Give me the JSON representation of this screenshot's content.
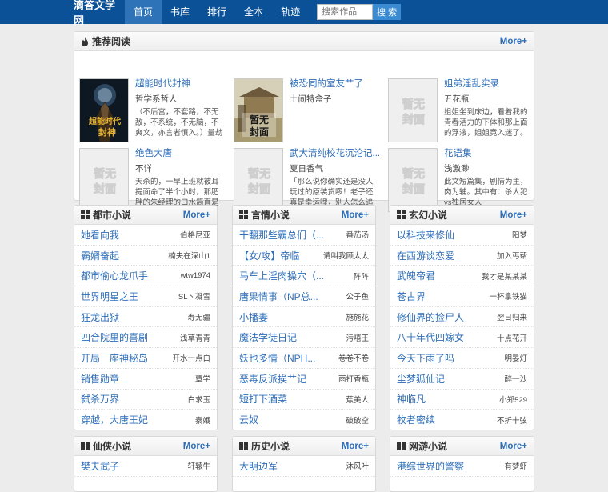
{
  "header": {
    "logo": "滴答文学网",
    "nav": [
      {
        "label": "首页",
        "active": true
      },
      {
        "label": "书库",
        "active": false
      },
      {
        "label": "排行",
        "active": false
      },
      {
        "label": "全本",
        "active": false
      },
      {
        "label": "轨迹",
        "active": false
      }
    ],
    "search_placeholder": "搜索作品",
    "search_button": "搜 索"
  },
  "placeholder_cover_text": [
    "暂无",
    "封面"
  ],
  "recommend": {
    "title": "推荐阅读",
    "more": "More+",
    "books": [
      {
        "title": "超能时代封神",
        "author": "哲学系哲人",
        "desc": "（不后宫，不套路，不无敌，不系统，不无脑，不爽文，亦言者慎入。）量劫再起，五维",
        "cover": "art1",
        "cover_text": [
          "超能时代",
          "封神"
        ]
      },
      {
        "title": "被恐同的室友艹了",
        "author": "土间特盒子",
        "desc": "",
        "cover": "art2",
        "cover_text": [
          "暂无",
          "封面"
        ]
      },
      {
        "title": "姐弟淫乱实录",
        "author": "五花瓶",
        "desc": "姐姐坐到床边，看着我的青春活力的下体和那上面的浮液，姐姐竟入迷了。",
        "cover": "placeholder"
      },
      {
        "title": "绝色大唐",
        "author": "不详",
        "desc": "天杀的，一早上班就被耳提面命了半个小时，那肥胖的朱经理的口水简直是 黄河缺堤，飞",
        "cover": "placeholder"
      },
      {
        "title": "武大清纯校花沉沦记...",
        "author": "夏日香气",
        "desc": "「那么说你确实还是没人玩过的原装货啰！老子还真是幸运哩，别人怎么追也追不到的t大",
        "cover": "placeholder"
      },
      {
        "title": "花语集",
        "author": "浅激渺",
        "desc": "此文短篇集，剧情为主，肉为辅。其中有：杀人犯vs独居女人",
        "cover": "placeholder"
      }
    ]
  },
  "categories": [
    {
      "title": "都市小说",
      "more": "More+",
      "items": [
        {
          "title": "她看向我",
          "author": "伯格尼亚"
        },
        {
          "title": "霸婿奋起",
          "author": "楠夫在深山1"
        },
        {
          "title": "都市偷心龙爪手",
          "author": "wtw1974"
        },
        {
          "title": "世界明星之王",
          "author": "SL丶凝雪"
        },
        {
          "title": "狂龙出狱",
          "author": "寿无疆"
        },
        {
          "title": "四合院里的喜剧",
          "author": "浅草青青"
        },
        {
          "title": "开局一座神秘岛",
          "author": "开水一点白"
        },
        {
          "title": "销售勋章",
          "author": "覃学"
        },
        {
          "title": "弑杀万界",
          "author": "白求玉"
        },
        {
          "title": "穿越，大唐王妃",
          "author": "秦娥"
        }
      ]
    },
    {
      "title": "言情小说",
      "more": "More+",
      "items": [
        {
          "title": "干翻那些霸总们（...",
          "author": "番茄汤"
        },
        {
          "title": "【女/攻】帝临",
          "author": "请叫我顾太太"
        },
        {
          "title": "马车上淫肉操穴（...",
          "author": "阵阵"
        },
        {
          "title": "唐果情事（NP总...",
          "author": "公子鱼"
        },
        {
          "title": "小播妻",
          "author": "施施花"
        },
        {
          "title": "魔法学徒日记",
          "author": "污嘻王"
        },
        {
          "title": "妖也多情（NPH...",
          "author": "卷卷不卷"
        },
        {
          "title": "恶毒反派挨艹记",
          "author": "雨打香瓶"
        },
        {
          "title": "短打下酒菜",
          "author": "蕉美人"
        },
        {
          "title": "云奴",
          "author": "破破空"
        }
      ]
    },
    {
      "title": "玄幻小说",
      "more": "More+",
      "items": [
        {
          "title": "以科技来修仙",
          "author": "阳梦"
        },
        {
          "title": "在西游谈恋爱",
          "author": "加入丐帮"
        },
        {
          "title": "武魄帝君",
          "author": "我才是某某某"
        },
        {
          "title": "苍古界",
          "author": "一杯拿铁猫"
        },
        {
          "title": "修仙界的捡尸人",
          "author": "翌日归来"
        },
        {
          "title": "八十年代四嫁女",
          "author": "十点花开"
        },
        {
          "title": "今天下雨了吗",
          "author": "明晏灯"
        },
        {
          "title": "尘梦狐仙记",
          "author": "醉一沙"
        },
        {
          "title": "神临凡",
          "author": "小郑529"
        },
        {
          "title": "牧者密续",
          "author": "不折十弦"
        }
      ]
    },
    {
      "title": "仙侠小说",
      "more": "More+",
      "items": [
        {
          "title": "樊夫武子",
          "author": "轩辕牛"
        }
      ]
    },
    {
      "title": "历史小说",
      "more": "More+",
      "items": [
        {
          "title": "大明边军",
          "author": "沐风叶"
        }
      ]
    },
    {
      "title": "网游小说",
      "more": "More+",
      "items": [
        {
          "title": "港综世界的警察",
          "author": "有梦虾"
        }
      ]
    }
  ]
}
